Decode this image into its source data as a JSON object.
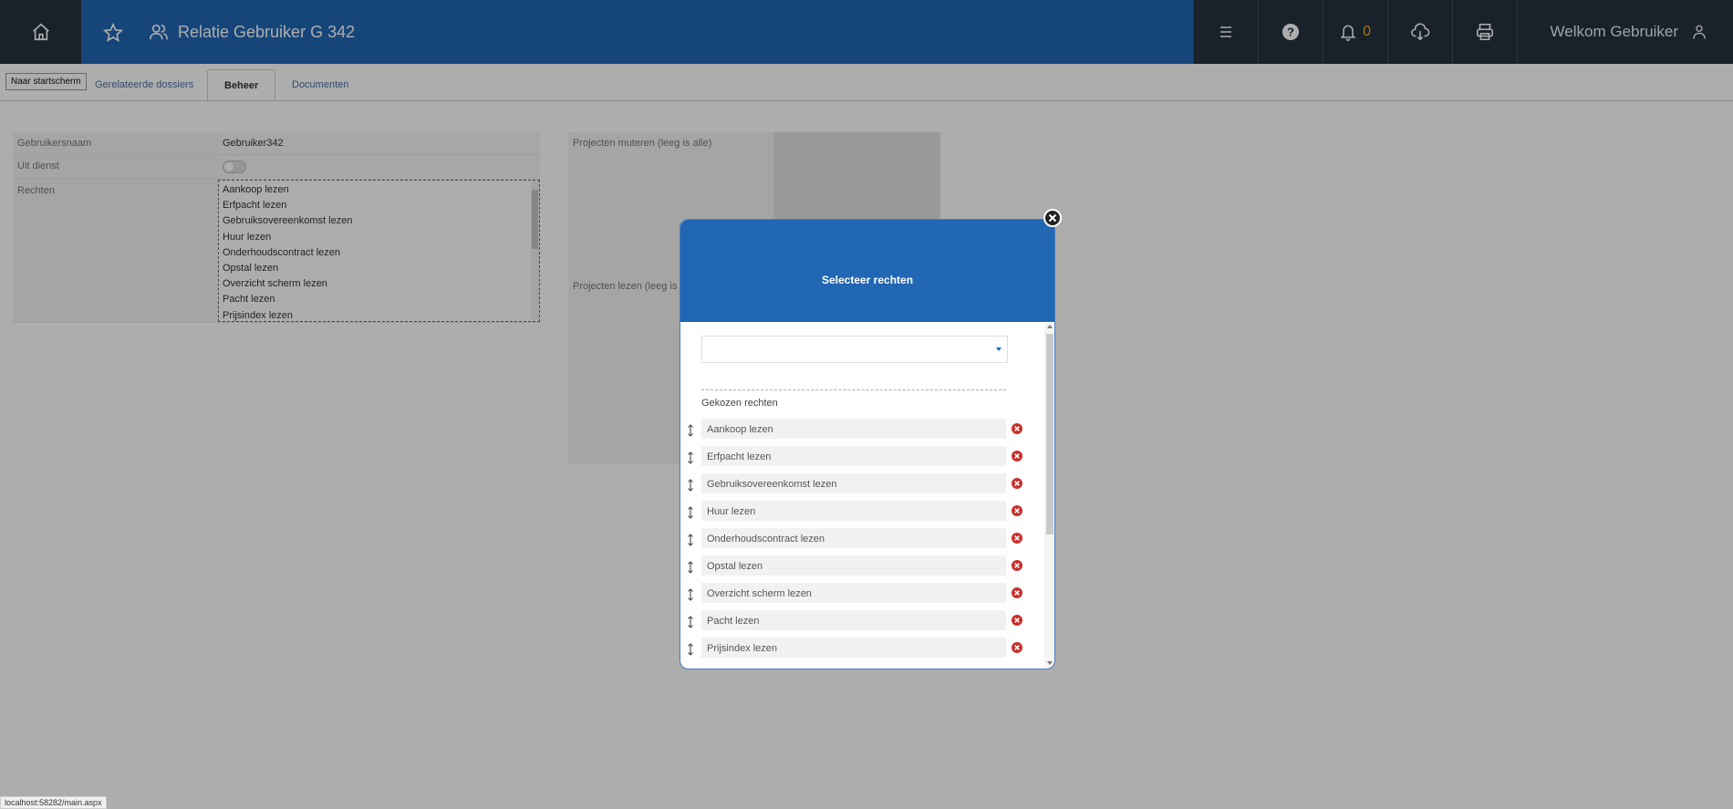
{
  "header": {
    "title": "Relatie Gebruiker G 342",
    "notifications_count": "0",
    "welcome": "Welkom Gebruiker"
  },
  "tooltip": "Naar startscherm",
  "tabs": [
    {
      "label": "Gerelateerde dossiers",
      "active": false
    },
    {
      "label": "Beheer",
      "active": true
    },
    {
      "label": "Documenten",
      "active": false
    }
  ],
  "form": {
    "username_label": "Gebruikersnaam",
    "username_value": "Gebruiker342",
    "out_of_service_label": "Uit dienst",
    "rights_label": "Rechten",
    "rights": [
      "Aankoop lezen",
      "Erfpacht lezen",
      "Gebruiksovereenkomst lezen",
      "Huur lezen",
      "Onderhoudscontract lezen",
      "Opstal lezen",
      "Overzicht scherm lezen",
      "Pacht lezen",
      "Prijsindex lezen"
    ],
    "projects_mutate_label": "Projecten muteren (leeg is alle)",
    "projects_read_label": "Projecten lezen (leeg is a"
  },
  "modal": {
    "title": "Selecteer rechten",
    "select_value": "",
    "chosen_title": "Gekozen rechten",
    "chosen": [
      "Aankoop lezen",
      "Erfpacht lezen",
      "Gebruiksovereenkomst lezen",
      "Huur lezen",
      "Onderhoudscontract lezen",
      "Opstal lezen",
      "Overzicht scherm lezen",
      "Pacht lezen",
      "Prijsindex lezen"
    ]
  },
  "status_url": "localhost:58282/main.aspx"
}
